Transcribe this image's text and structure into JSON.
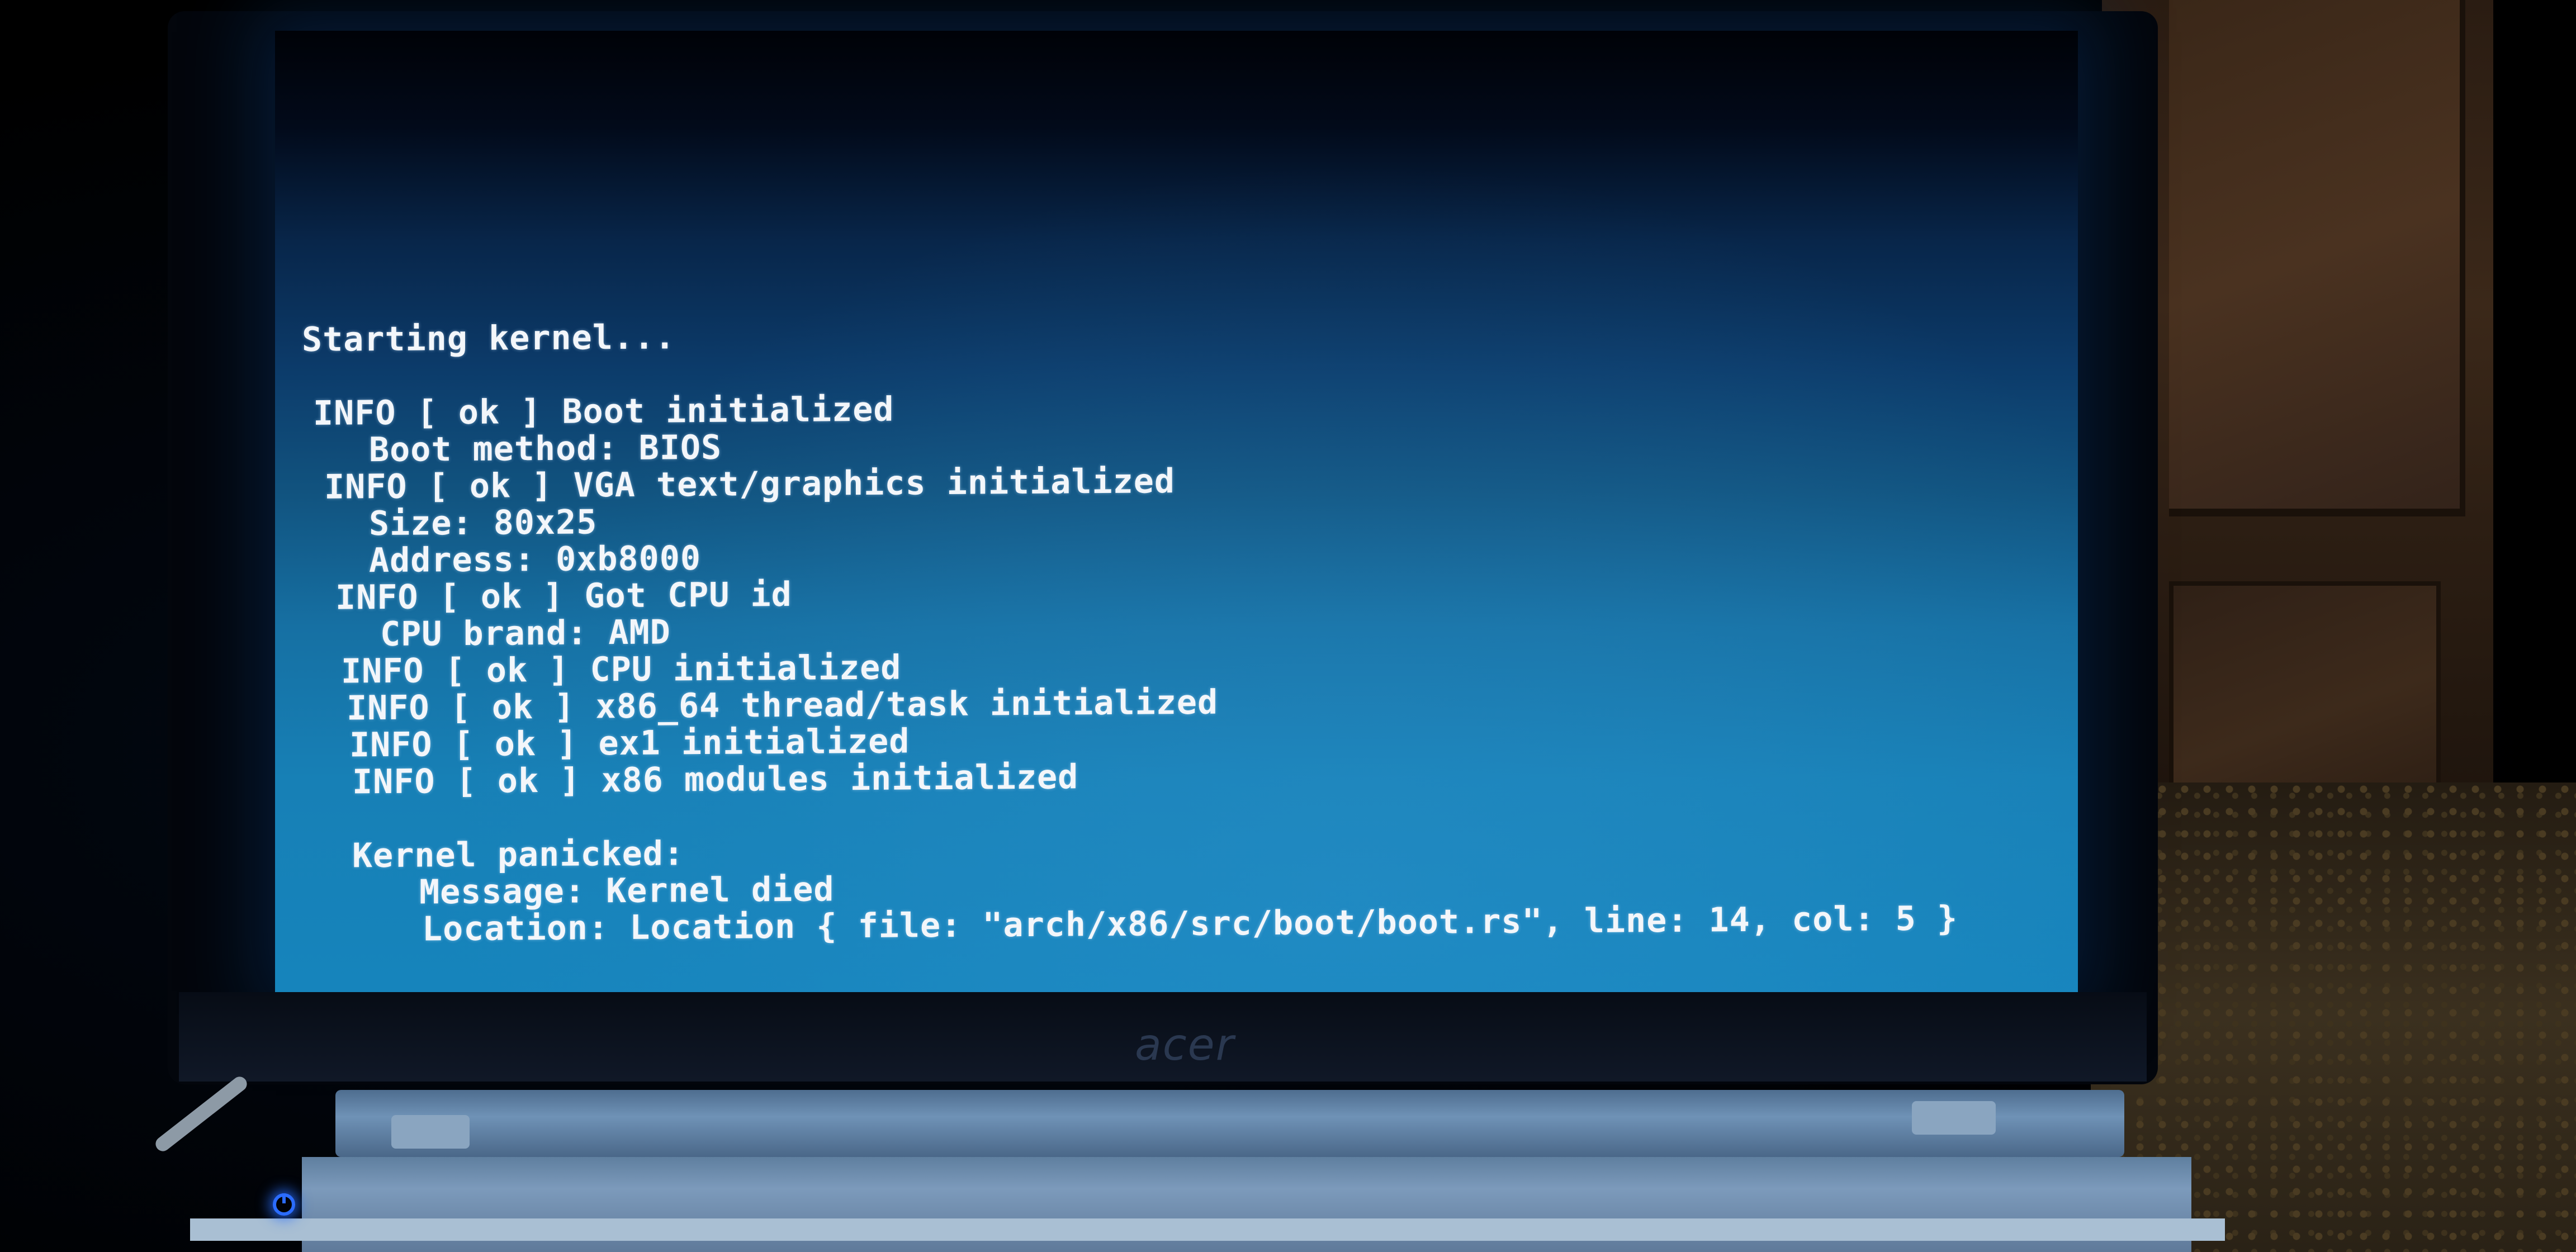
{
  "terminal": {
    "starting": "Starting kernel...",
    "lines": [
      "INFO [ ok ] Boot initialized",
      "Boot method: BIOS",
      "INFO [ ok ] VGA text/graphics initialized",
      "Size: 80x25",
      "Address: 0xb8000",
      "INFO [ ok ] Got CPU id",
      "CPU brand: AMD",
      "INFO [ ok ] CPU initialized",
      "INFO [ ok ] x86_64 thread/task initialized",
      "INFO [ ok ] ex1 initialized",
      "INFO [ ok ] x86 modules initialized"
    ],
    "panic_title": "Kernel panicked:",
    "panic_message": "Message: Kernel died",
    "panic_location": "Location: Location { file: \"arch/x86/src/boot/boot.rs\", line: 14, col: 5 }"
  },
  "laptop": {
    "brand": "acer",
    "power_icon": "power-icon"
  },
  "colors": {
    "screen_top": "#000207",
    "screen_bottom": "#1684bc",
    "text": "#f3f6fa",
    "power_led": "#2b6cff"
  }
}
